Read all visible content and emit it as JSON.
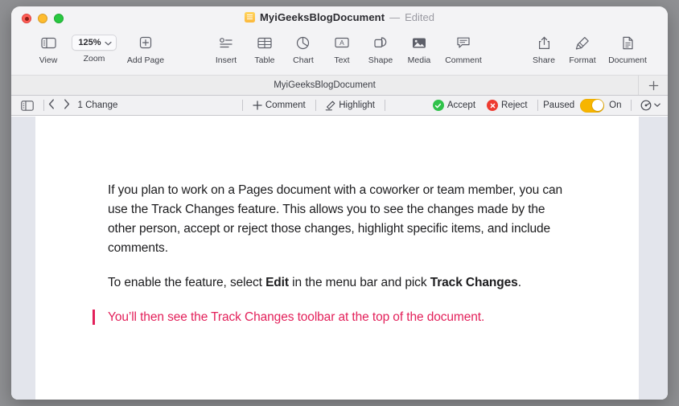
{
  "window": {
    "traffic_lights": [
      "close",
      "minimize",
      "zoom"
    ],
    "title": "MyiGeeksBlogDocument",
    "title_separator": "—",
    "edited_status": "Edited"
  },
  "toolbar": {
    "items": [
      {
        "icon": "sidebar-icon",
        "label": "View"
      },
      {
        "icon": "zoom-icon",
        "label": "Zoom",
        "value": "125%"
      },
      {
        "icon": "add-page-icon",
        "label": "Add Page"
      },
      {
        "icon": "insert-icon",
        "label": "Insert"
      },
      {
        "icon": "table-icon",
        "label": "Table"
      },
      {
        "icon": "chart-icon",
        "label": "Chart"
      },
      {
        "icon": "text-icon",
        "label": "Text"
      },
      {
        "icon": "shape-icon",
        "label": "Shape"
      },
      {
        "icon": "media-icon",
        "label": "Media"
      },
      {
        "icon": "comment-icon",
        "label": "Comment"
      },
      {
        "icon": "share-icon",
        "label": "Share"
      },
      {
        "icon": "format-icon",
        "label": "Format"
      },
      {
        "icon": "document-icon",
        "label": "Document"
      }
    ]
  },
  "tabbar": {
    "active_tab": "MyiGeeksBlogDocument",
    "add_tab_label": "+"
  },
  "trackbar": {
    "sidebar_toggle": "sidebar-icon",
    "prev_label": "‹",
    "next_label": "›",
    "change_count": "1 Change",
    "comment_label": "Comment",
    "comment_icon": "plus-icon",
    "highlight_label": "Highlight",
    "highlight_icon": "highlighter-icon",
    "accept_label": "Accept",
    "accept_icon": "check-circle-icon",
    "reject_label": "Reject",
    "reject_icon": "x-circle-icon",
    "state_label": "Paused",
    "toggle_state": "on",
    "toggle_label": "On",
    "options_icon": "tracking-options-icon",
    "colors": {
      "accept": "#30c24a",
      "reject": "#ee3b30",
      "toggle_on": "#f7b500"
    }
  },
  "document": {
    "paragraphs": [
      {
        "type": "plain",
        "text": "If you plan to work on a Pages document with a coworker or team member, you can use the Track Changes feature. This allows you to see the changes made by the other person, accept or reject those changes, highlight specific items, and include comments."
      }
    ],
    "paragraph2": {
      "part1": "To enable the feature, select ",
      "bold1": "Edit",
      "part2": " in the menu bar and pick ",
      "bold2": "Track Changes",
      "part3": "."
    },
    "tracked_change": {
      "text": "You’ll then see the Track Changes toolbar at the top of the document.",
      "color": "#e3205a"
    }
  }
}
